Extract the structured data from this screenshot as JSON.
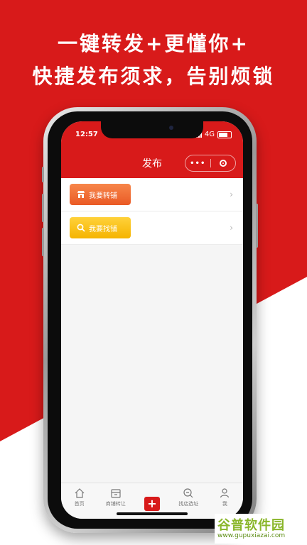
{
  "banner": {
    "line1": "一键转发+更懂你+",
    "line2": "快捷发布须求，告别烦锁"
  },
  "status_bar": {
    "time": "12:57",
    "network": "4G"
  },
  "nav": {
    "title": "发布",
    "more_label": "•••"
  },
  "list": [
    {
      "label": "我要转铺",
      "icon": "store-icon",
      "color": "#ee6a2f"
    },
    {
      "label": "我要找铺",
      "icon": "search-icon",
      "color": "#f7c21a"
    }
  ],
  "tabbar": {
    "tabs": [
      {
        "label": "首页",
        "icon": "home-icon"
      },
      {
        "label": "商铺转让",
        "icon": "shop-icon"
      },
      {
        "label": "",
        "icon": "plus-icon"
      },
      {
        "label": "找店选址",
        "icon": "map-search-icon"
      },
      {
        "label": "我",
        "icon": "user-icon"
      }
    ],
    "add_symbol": "+"
  },
  "watermark": {
    "brand": "谷普软件园",
    "url": "www.gupuxiazai.com"
  },
  "colors": {
    "brand_red": "#d81a1a",
    "orange": "#ee6a2f",
    "yellow": "#f7c21a"
  }
}
